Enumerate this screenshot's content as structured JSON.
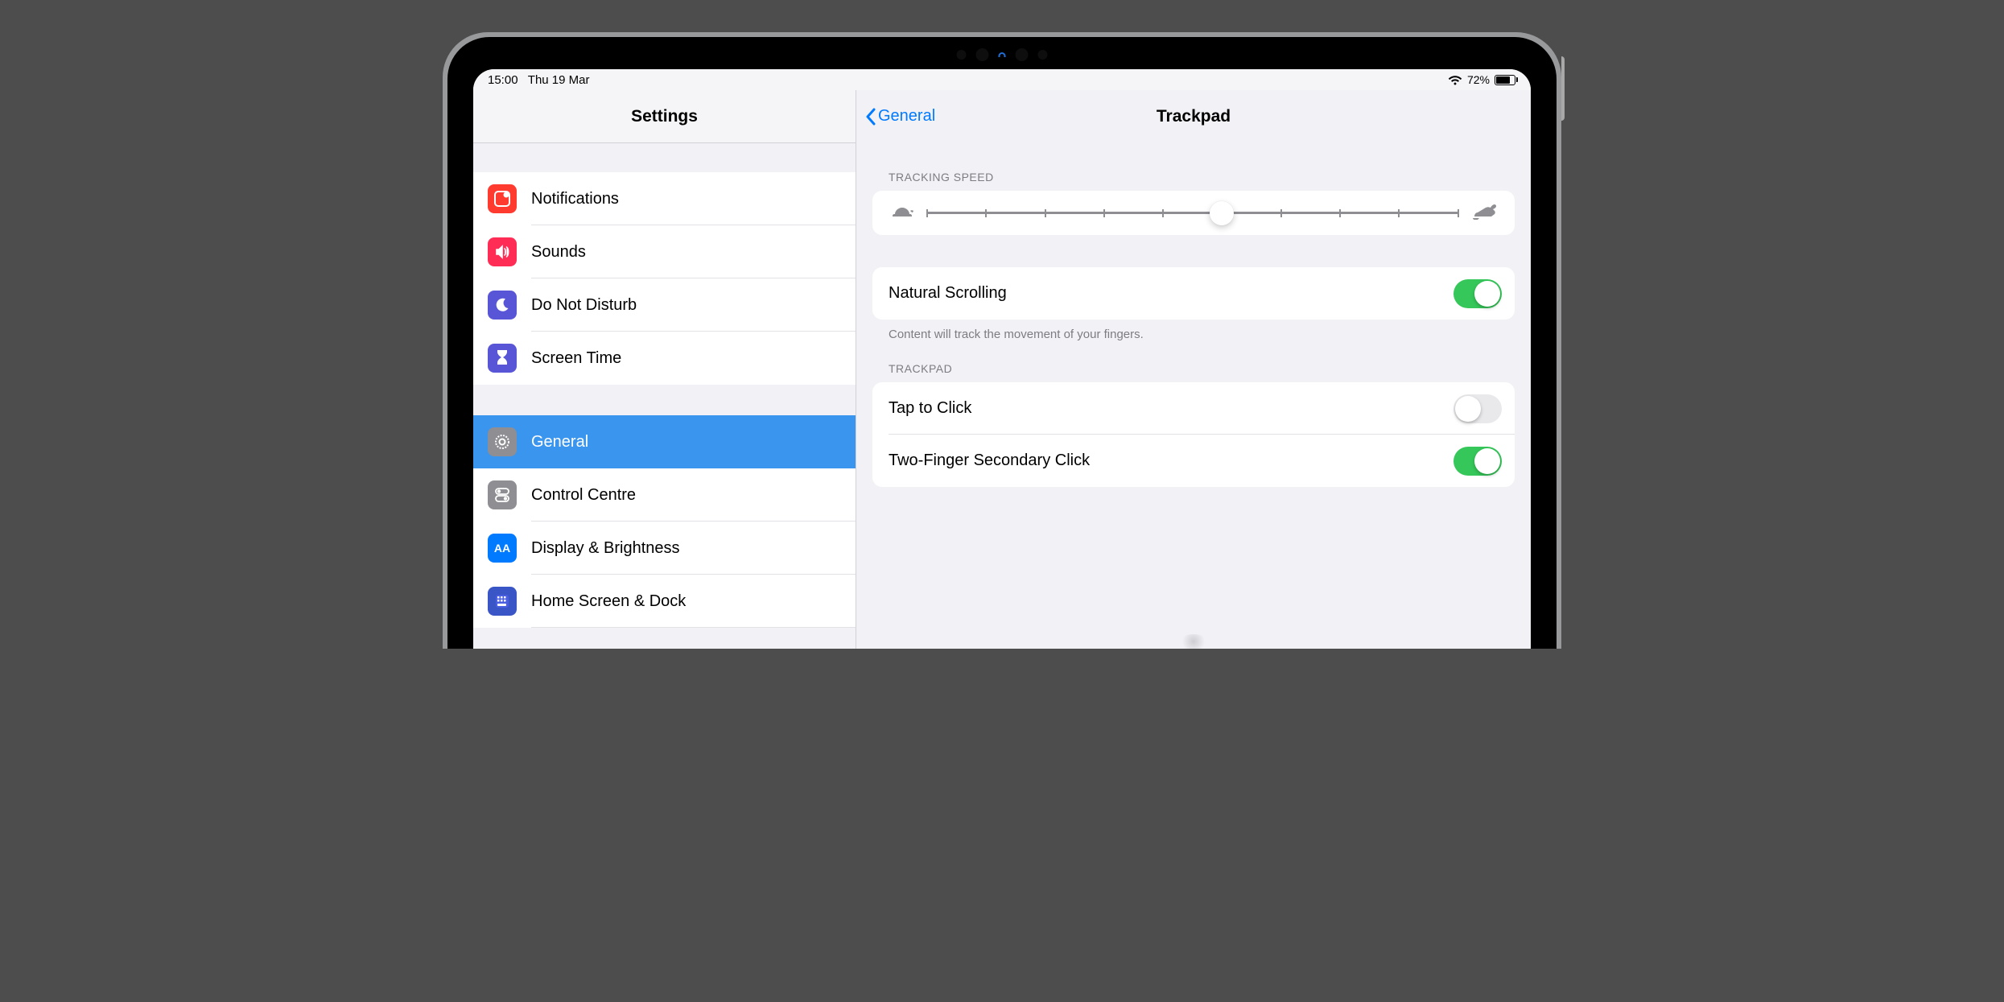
{
  "status": {
    "time": "15:00",
    "date": "Thu 19 Mar",
    "battery": "72%"
  },
  "sidebar": {
    "title": "Settings",
    "group1": [
      {
        "label": "Notifications",
        "icon": "notifications",
        "bg": "#ff3b30"
      },
      {
        "label": "Sounds",
        "icon": "sounds",
        "bg": "#ff2d55"
      },
      {
        "label": "Do Not Disturb",
        "icon": "dnd",
        "bg": "#5856d6"
      },
      {
        "label": "Screen Time",
        "icon": "screentime",
        "bg": "#5856d6"
      }
    ],
    "group2": [
      {
        "label": "General",
        "icon": "general",
        "bg": "#8e8e93",
        "selected": true
      },
      {
        "label": "Control Centre",
        "icon": "control",
        "bg": "#8e8e93"
      },
      {
        "label": "Display & Brightness",
        "icon": "display",
        "bg": "#007aff"
      },
      {
        "label": "Home Screen & Dock",
        "icon": "home",
        "bg": "#3955c6"
      }
    ]
  },
  "main": {
    "back": "General",
    "title": "Trackpad",
    "tracking_header": "TRACKING SPEED",
    "slider": {
      "value": 5,
      "ticks": 10
    },
    "natural_scrolling": {
      "label": "Natural Scrolling",
      "on": true
    },
    "natural_note": "Content will track the movement of your fingers.",
    "trackpad_header": "TRACKPAD",
    "tap_to_click": {
      "label": "Tap to Click",
      "on": false
    },
    "two_finger": {
      "label": "Two-Finger Secondary Click",
      "on": true
    }
  }
}
